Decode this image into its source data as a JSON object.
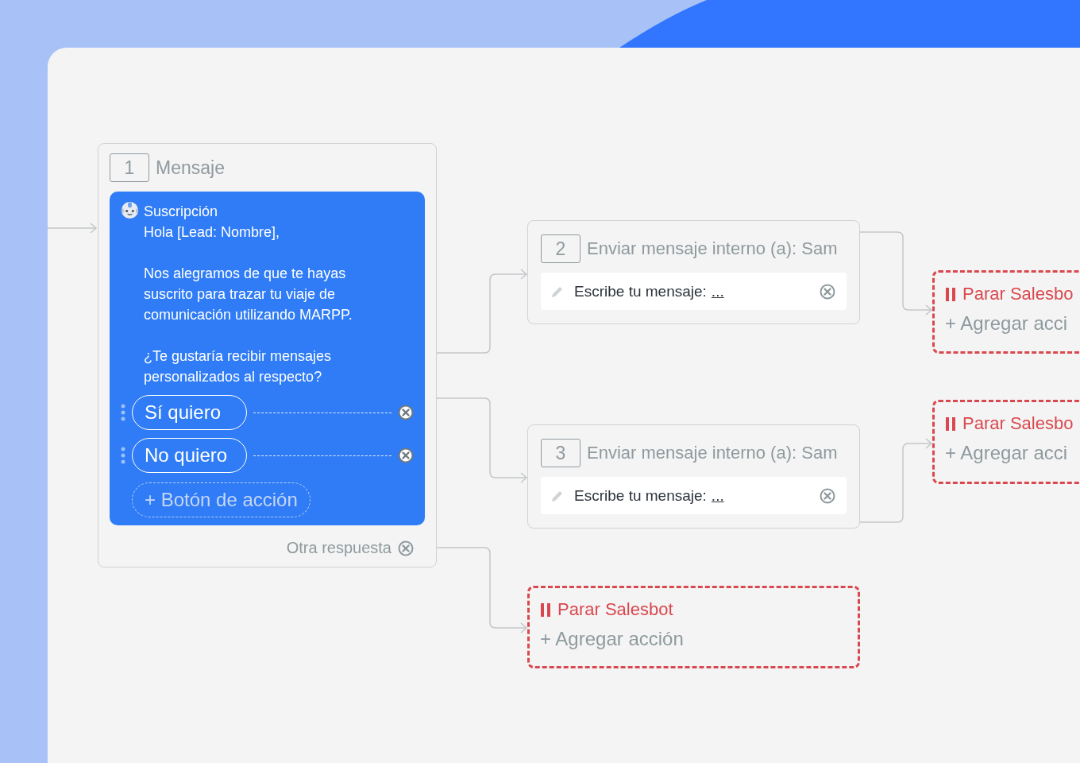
{
  "canvas": {
    "nodes": [
      {
        "kind": "message",
        "number": "1",
        "title": "Mensaje",
        "sender": "Suscripción",
        "paragraphs": [
          "Hola [Lead: Nombre],",
          "Nos alegramos de que te hayas suscrito para trazar tu viaje de comunicación utilizando MARPP.",
          "¿Te gustaría recibir mensajes personalizados al respecto?"
        ],
        "buttons": [
          {
            "label": "Sí quiero"
          },
          {
            "label": "No quiero"
          }
        ],
        "add_button": "+ Botón de acción",
        "fallback": "Otra respuesta"
      },
      {
        "kind": "internal_message",
        "number": "2",
        "title": "Enviar mensaje interno (a): Sam",
        "field_label": "Escribe tu mensaje:",
        "field_value": "..."
      },
      {
        "kind": "internal_message",
        "number": "3",
        "title": "Enviar mensaje interno (a): Sam",
        "field_label": "Escribe tu mensaje:",
        "field_value": "..."
      },
      {
        "kind": "stop",
        "label": "Parar Salesbot",
        "add_action": "+ Agregar acción"
      },
      {
        "kind": "stop",
        "label": "Parar Salesbo",
        "add_action": "+ Agregar acci"
      },
      {
        "kind": "stop",
        "label": "Parar Salesbo",
        "add_action": "+ Agregar acci"
      }
    ]
  }
}
